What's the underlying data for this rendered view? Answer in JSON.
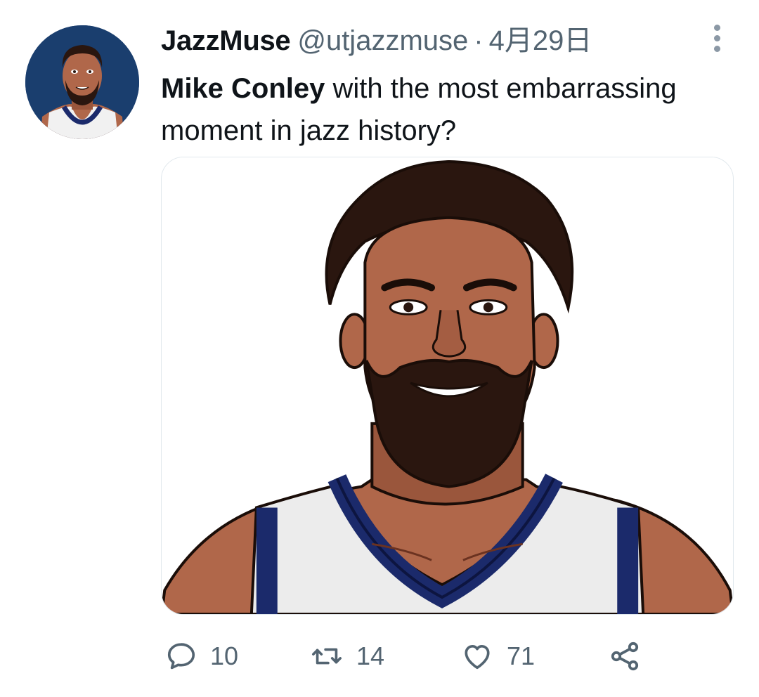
{
  "tweet": {
    "display_name": "JazzMuse",
    "handle": "@utjazzmuse",
    "separator": "·",
    "date": "4月29日",
    "text_mention": "Mike Conley",
    "text_body": " with the most embarrassing moment in jazz history?"
  },
  "actions": {
    "reply": {
      "icon": "reply-bubble-icon",
      "count": "10"
    },
    "retweet": {
      "icon": "retweet-icon",
      "count": "14"
    },
    "like": {
      "icon": "heart-icon",
      "count": "71"
    },
    "share": {
      "icon": "share-icon"
    }
  },
  "colors": {
    "text_primary": "#0f1419",
    "text_secondary": "#536471",
    "jersey_navy": "#1b2a6b",
    "skin": "#b0674a",
    "avatar_bg": "#1a3e6e"
  }
}
